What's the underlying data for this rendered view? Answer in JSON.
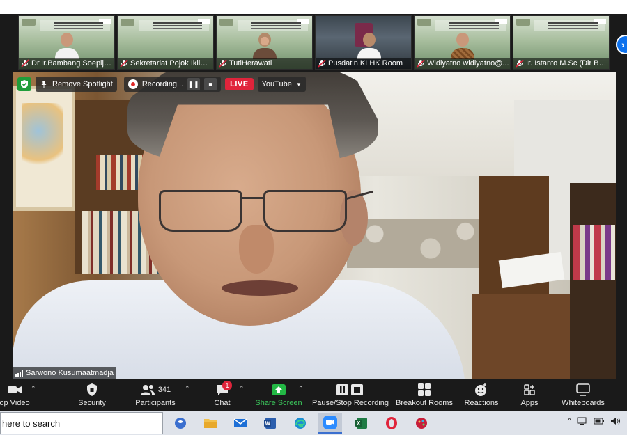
{
  "thumbnails": [
    {
      "name": "Dr.Ir.Bambang Soepija...",
      "kind": "slide",
      "person": "man"
    },
    {
      "name": "Sekretariat Pojok Iklim - A...",
      "kind": "slide",
      "person": "none"
    },
    {
      "name": "TutiHerawati",
      "kind": "slide",
      "person": "hijab"
    },
    {
      "name": "Pusdatin KLHK Room",
      "kind": "room",
      "person": "man"
    },
    {
      "name": "Widiyatno widiyatno@...",
      "kind": "slide",
      "person": "batik"
    },
    {
      "name": "Ir. Istanto M.Sc (Dir BU...",
      "kind": "slide",
      "person": "none"
    }
  ],
  "overlay": {
    "remove_spotlight": "Remove Spotlight",
    "recording": "Recording...",
    "live": "LIVE",
    "youtube": "YouTube"
  },
  "active_speaker": "Sarwono Kusumaatmadja",
  "toolbar": {
    "stop_video": "op Video",
    "security": "Security",
    "participants": "Participants",
    "participants_count": "341",
    "chat": "Chat",
    "chat_badge": "1",
    "share_screen": "Share Screen",
    "pause_stop_recording": "Pause/Stop Recording",
    "breakout_rooms": "Breakout Rooms",
    "reactions": "Reactions",
    "apps": "Apps",
    "whiteboards": "Whiteboards"
  },
  "taskbar": {
    "search_placeholder": "here to search",
    "apps": [
      "teams-icon",
      "file-explorer-icon",
      "mail-icon",
      "word-icon",
      "edge-icon",
      "zoom-icon",
      "excel-icon",
      "opera-icon",
      "paint-icon"
    ]
  },
  "colors": {
    "zoom_blue": "#0e72ed",
    "live_red": "#e0243b",
    "share_green": "#3ac45a",
    "toolbar_bg": "#1a1a1a",
    "taskbar_bg": "#dfe3ea"
  }
}
